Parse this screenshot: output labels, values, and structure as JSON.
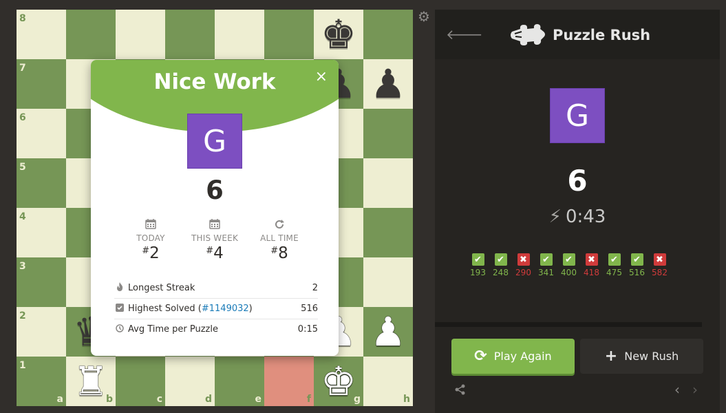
{
  "board": {
    "ranks": [
      "8",
      "7",
      "6",
      "5",
      "4",
      "3",
      "2",
      "1"
    ],
    "files": [
      "a",
      "b",
      "c",
      "d",
      "e",
      "f",
      "g",
      "h"
    ]
  },
  "modal": {
    "title": "Nice Work",
    "close": "×",
    "avatar_letter": "G",
    "score": "6",
    "stats": [
      {
        "icon": "calendar-icon",
        "label": "TODAY",
        "hash": "#",
        "value": "2"
      },
      {
        "icon": "calendar-icon",
        "label": "THIS WEEK",
        "hash": "#",
        "value": "4"
      },
      {
        "icon": "refresh-icon",
        "label": "ALL TIME",
        "hash": "#",
        "value": "8"
      }
    ],
    "longest_streak": {
      "label": "Longest Streak",
      "value": "2"
    },
    "highest_solved": {
      "label": "Highest Solved",
      "link_open": "(",
      "link": "#1149032",
      "link_close": ")",
      "value": "516"
    },
    "avg_time": {
      "label": "Avg Time per Puzzle",
      "value": "0:15"
    }
  },
  "panel": {
    "title": "Puzzle Rush",
    "avatar_letter": "G",
    "score": "6",
    "timer": "0:43",
    "results": [
      {
        "value": "193",
        "status": "correct"
      },
      {
        "value": "248",
        "status": "correct"
      },
      {
        "value": "290",
        "status": "wrong"
      },
      {
        "value": "341",
        "status": "correct"
      },
      {
        "value": "400",
        "status": "correct"
      },
      {
        "value": "418",
        "status": "wrong"
      },
      {
        "value": "475",
        "status": "correct"
      },
      {
        "value": "516",
        "status": "correct"
      },
      {
        "value": "582",
        "status": "wrong"
      }
    ],
    "play_again": "Play Again",
    "new_rush": "New Rush"
  },
  "colors": {
    "green": "#81b64c",
    "red": "#d03b3b",
    "purple": "#7d4fc1",
    "board_light": "#eeeed2",
    "board_dark": "#769656",
    "highlight": "#e08f7e"
  }
}
